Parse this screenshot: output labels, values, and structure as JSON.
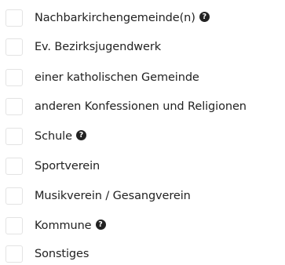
{
  "options": [
    {
      "label": "Nachbarkirchengemeinde(n)",
      "checked": false,
      "has_help": true,
      "help_icon": "question-circle-icon",
      "help_glyph": "?"
    },
    {
      "label": "Ev. Bezirksjugendwerk",
      "checked": false,
      "has_help": false
    },
    {
      "label": "einer katholischen Gemeinde",
      "checked": false,
      "has_help": false
    },
    {
      "label": "anderen Konfessionen und Religionen",
      "checked": false,
      "has_help": false
    },
    {
      "label": "Schule",
      "checked": false,
      "has_help": true,
      "help_icon": "question-circle-icon",
      "help_glyph": "?"
    },
    {
      "label": "Sportverein",
      "checked": false,
      "has_help": false
    },
    {
      "label": "Musikverein / Gesangverein",
      "checked": false,
      "has_help": false
    },
    {
      "label": "Kommune",
      "checked": false,
      "has_help": true,
      "help_icon": "question-circle-icon",
      "help_glyph": "?"
    },
    {
      "label": "Sonstiges",
      "checked": false,
      "has_help": false
    }
  ]
}
